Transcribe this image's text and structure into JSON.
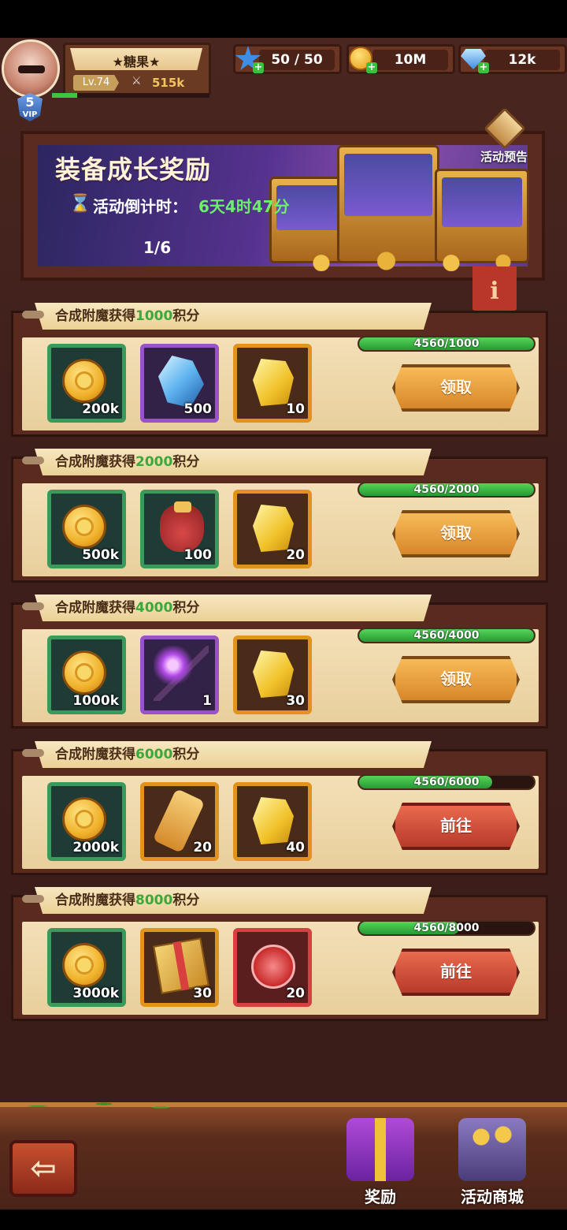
{
  "player": {
    "name": "★糖果★",
    "level": "Lv.74",
    "power": "515k",
    "vip_level": "5",
    "vip_label": "VIP",
    "exp_progress": 0.16
  },
  "resources": [
    {
      "name": "stamina",
      "value": "50 / 50",
      "icon": "star-icon"
    },
    {
      "name": "gold",
      "value": "10M",
      "icon": "coin-icon"
    },
    {
      "name": "diamond",
      "value": "12k",
      "icon": "diamond-icon"
    }
  ],
  "banner": {
    "title": "装备成长奖励",
    "countdown_label": "活动倒计时：",
    "countdown_value": "6天4时47分",
    "page": "1/6",
    "preview_label": "活动预告",
    "info_symbol": "i"
  },
  "tasks": [
    {
      "label_prefix": "合成附魔获得",
      "points": "1000",
      "label_suffix": "积分",
      "progress_text": "4560/1000",
      "progress": 1.0,
      "button": "领取",
      "button_type": "claim",
      "rewards": [
        {
          "icon": "gold-coin",
          "qty": "200k",
          "rarity": "green"
        },
        {
          "icon": "blue-crystal",
          "qty": "500",
          "rarity": "purple"
        },
        {
          "icon": "gold-crystal",
          "qty": "10",
          "rarity": "orange"
        }
      ]
    },
    {
      "label_prefix": "合成附魔获得",
      "points": "2000",
      "label_suffix": "积分",
      "progress_text": "4560/2000",
      "progress": 1.0,
      "button": "领取",
      "button_type": "claim",
      "rewards": [
        {
          "icon": "gold-coin",
          "qty": "500k",
          "rarity": "green"
        },
        {
          "icon": "red-bag",
          "qty": "100",
          "rarity": "green"
        },
        {
          "icon": "gold-crystal",
          "qty": "20",
          "rarity": "orange"
        }
      ]
    },
    {
      "label_prefix": "合成附魔获得",
      "points": "4000",
      "label_suffix": "积分",
      "progress_text": "4560/4000",
      "progress": 1.0,
      "button": "领取",
      "button_type": "claim",
      "rewards": [
        {
          "icon": "gold-coin",
          "qty": "1000k",
          "rarity": "green"
        },
        {
          "icon": "lightning-staff",
          "qty": "1",
          "rarity": "purple"
        },
        {
          "icon": "gold-crystal",
          "qty": "30",
          "rarity": "orange"
        }
      ]
    },
    {
      "label_prefix": "合成附魔获得",
      "points": "6000",
      "label_suffix": "积分",
      "progress_text": "4560/6000",
      "progress": 0.76,
      "button": "前往",
      "button_type": "go",
      "rewards": [
        {
          "icon": "gold-coin",
          "qty": "2000k",
          "rarity": "green"
        },
        {
          "icon": "enchant-scroll",
          "qty": "20",
          "rarity": "orange"
        },
        {
          "icon": "gold-crystal",
          "qty": "40",
          "rarity": "orange"
        }
      ]
    },
    {
      "label_prefix": "合成附魔获得",
      "points": "8000",
      "label_suffix": "积分",
      "progress_text": "4560/8000",
      "progress": 0.57,
      "button": "前往",
      "button_type": "go",
      "rewards": [
        {
          "icon": "gold-coin",
          "qty": "3000k",
          "rarity": "green"
        },
        {
          "icon": "rune-book",
          "qty": "30",
          "rarity": "orange"
        },
        {
          "icon": "paw-token",
          "qty": "20",
          "rarity": "red"
        }
      ]
    }
  ],
  "bottom_nav": {
    "back_symbol": "⇦",
    "items": [
      {
        "label": "奖励",
        "icon": "gift-box-icon"
      },
      {
        "label": "活动商城",
        "icon": "treasure-shop-icon"
      }
    ]
  }
}
